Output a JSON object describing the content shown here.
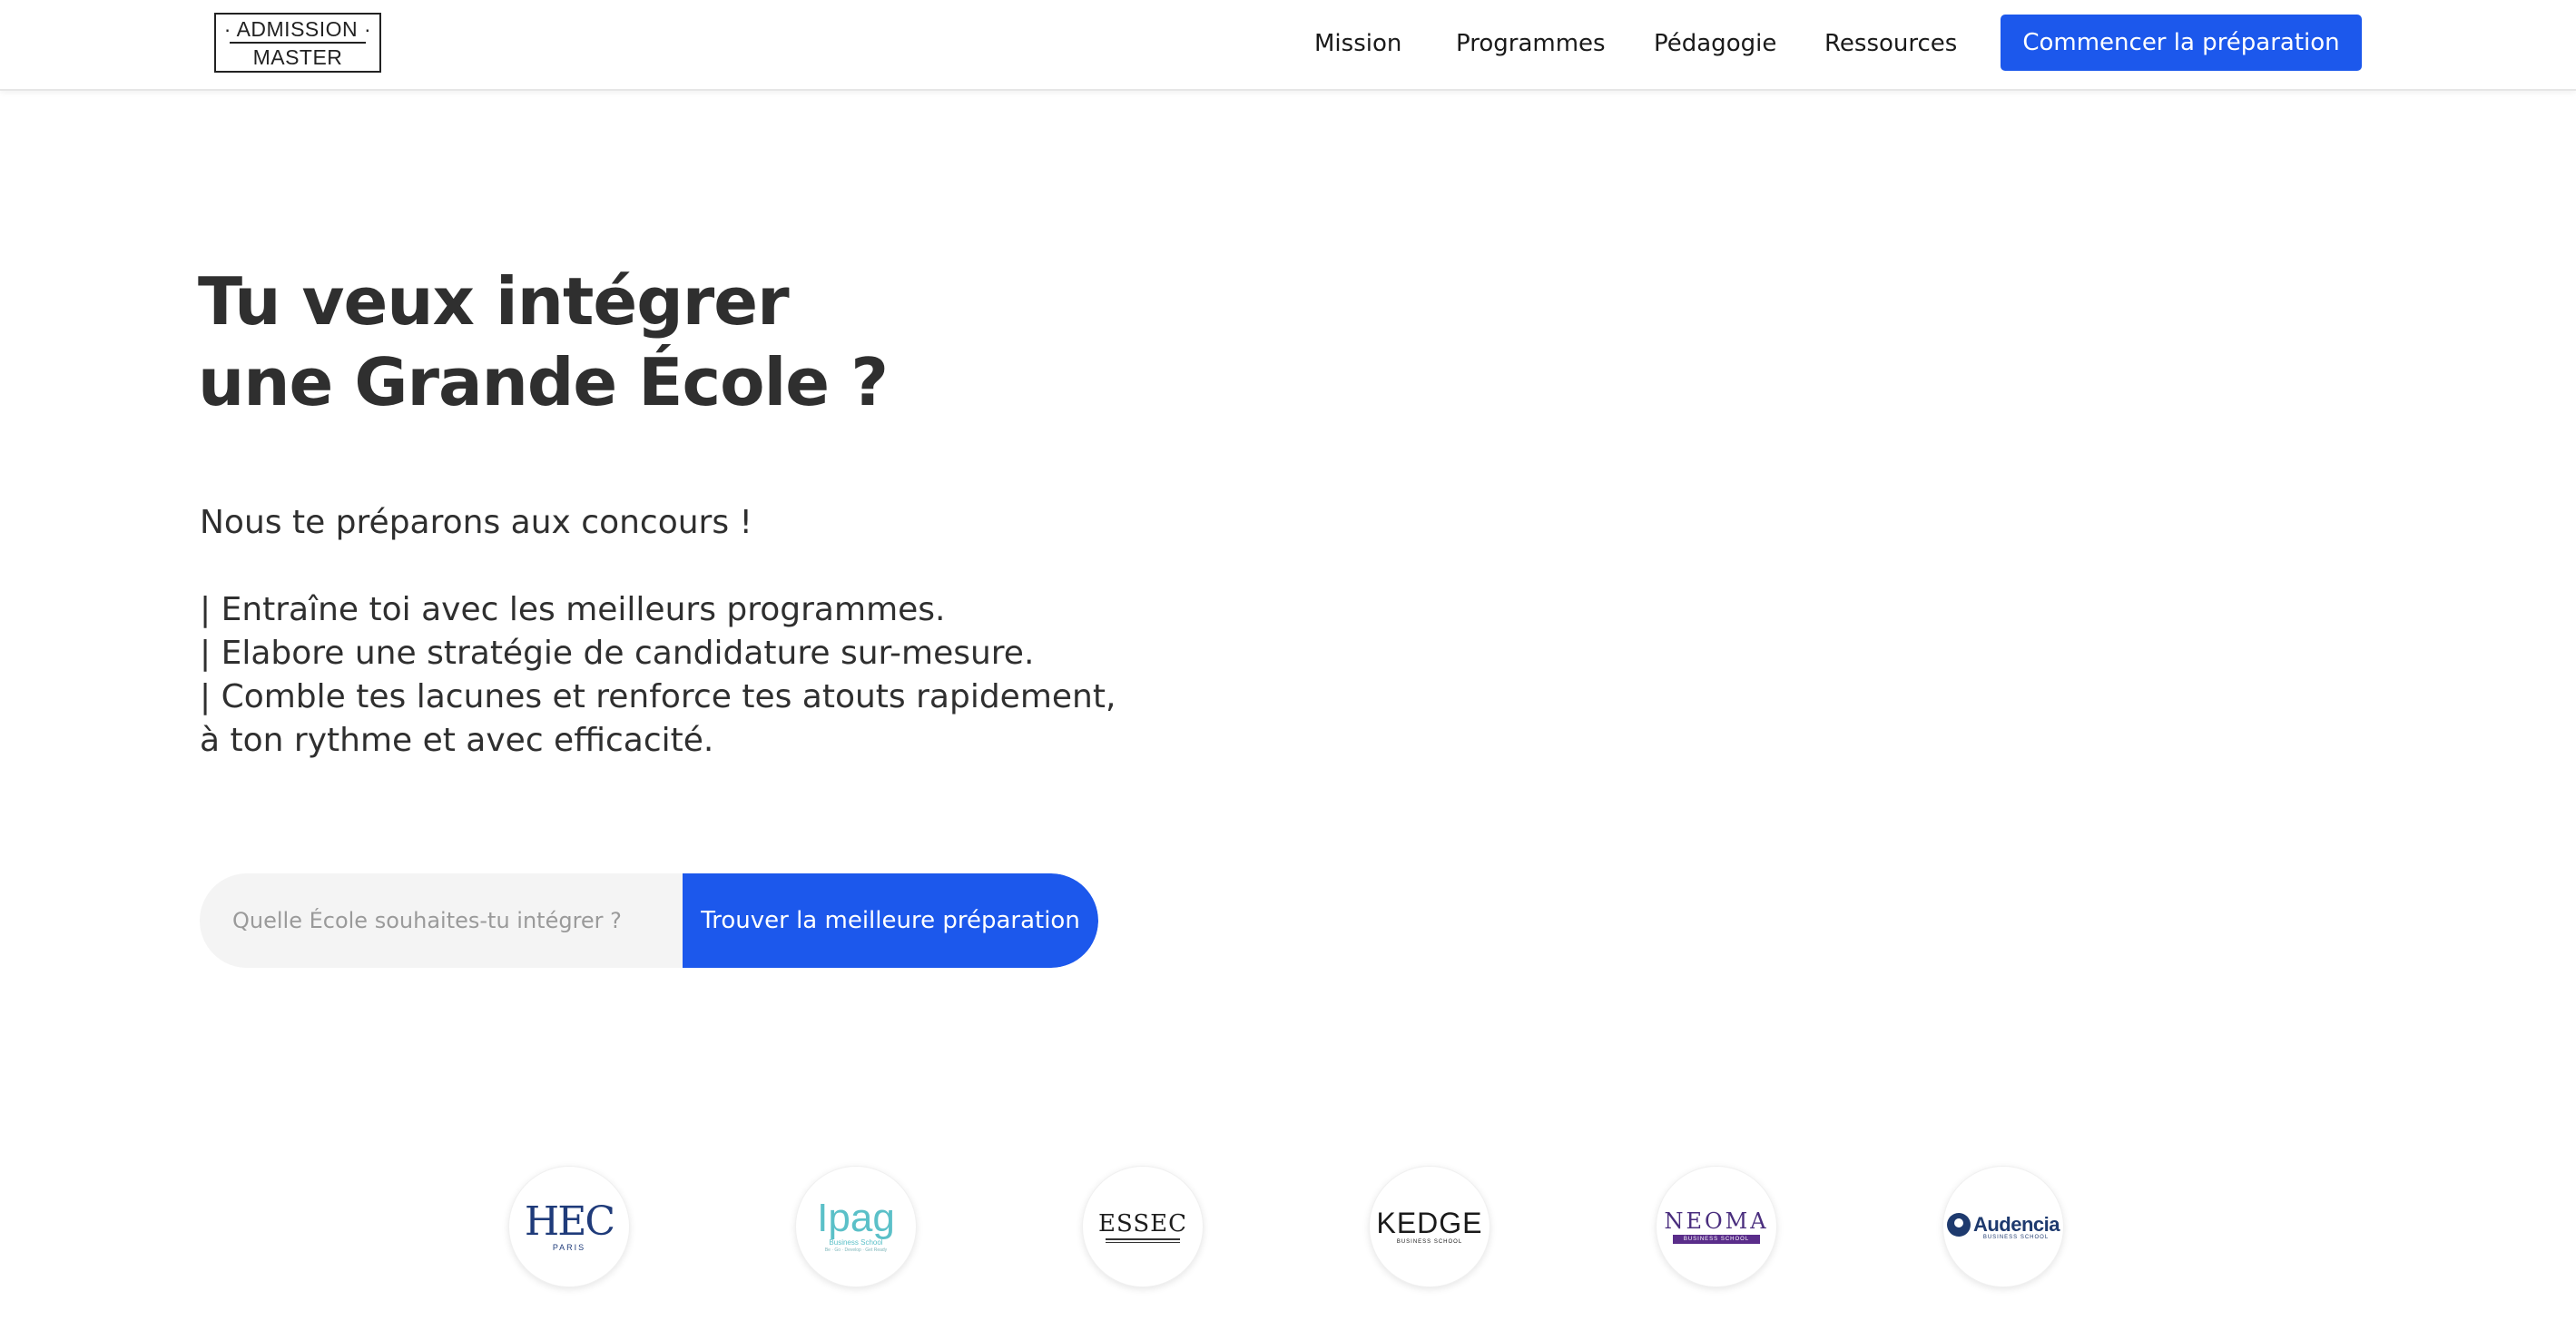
{
  "header": {
    "logo": {
      "line1": "ADMISSION",
      "line2": "MASTER"
    },
    "nav": [
      {
        "label": "Mission"
      },
      {
        "label": "Programmes"
      },
      {
        "label": "Pédagogie"
      },
      {
        "label": "Ressources"
      }
    ],
    "cta_label": "Commencer la préparation"
  },
  "hero": {
    "title_line1": "Tu veux intégrer",
    "title_line2": "une Grande École ?",
    "lead": "Nous te préparons aux concours !",
    "points": [
      "| Entraîne toi avec les meilleurs programmes.",
      "| Elabore une stratégie de candidature sur-mesure.",
      "| Comble tes lacunes et renforce tes atouts rapidement,",
      "à ton rythme et avec efficacité."
    ]
  },
  "search": {
    "placeholder": "Quelle École souhaites-tu intégrer ?",
    "value": "",
    "button_label": "Trouver la meilleure préparation"
  },
  "schools": [
    {
      "name": "HEC",
      "sub": "PARIS"
    },
    {
      "name": "Ipag",
      "sub": "Business School",
      "tagline": "Be · Go · Develop · Get Ready"
    },
    {
      "name": "ESSEC",
      "sub": "BUSINESS SCHOOL"
    },
    {
      "name": "KEDGE",
      "sub": "BUSINESS SCHOOL"
    },
    {
      "name": "NEOMA",
      "sub": "BUSINESS SCHOOL"
    },
    {
      "name": "Audencia",
      "sub": "BUSINESS SCHOOL"
    }
  ],
  "colors": {
    "accent": "#1c58ec",
    "text": "#2f2f2f",
    "search_bg": "#f4f4f4"
  }
}
